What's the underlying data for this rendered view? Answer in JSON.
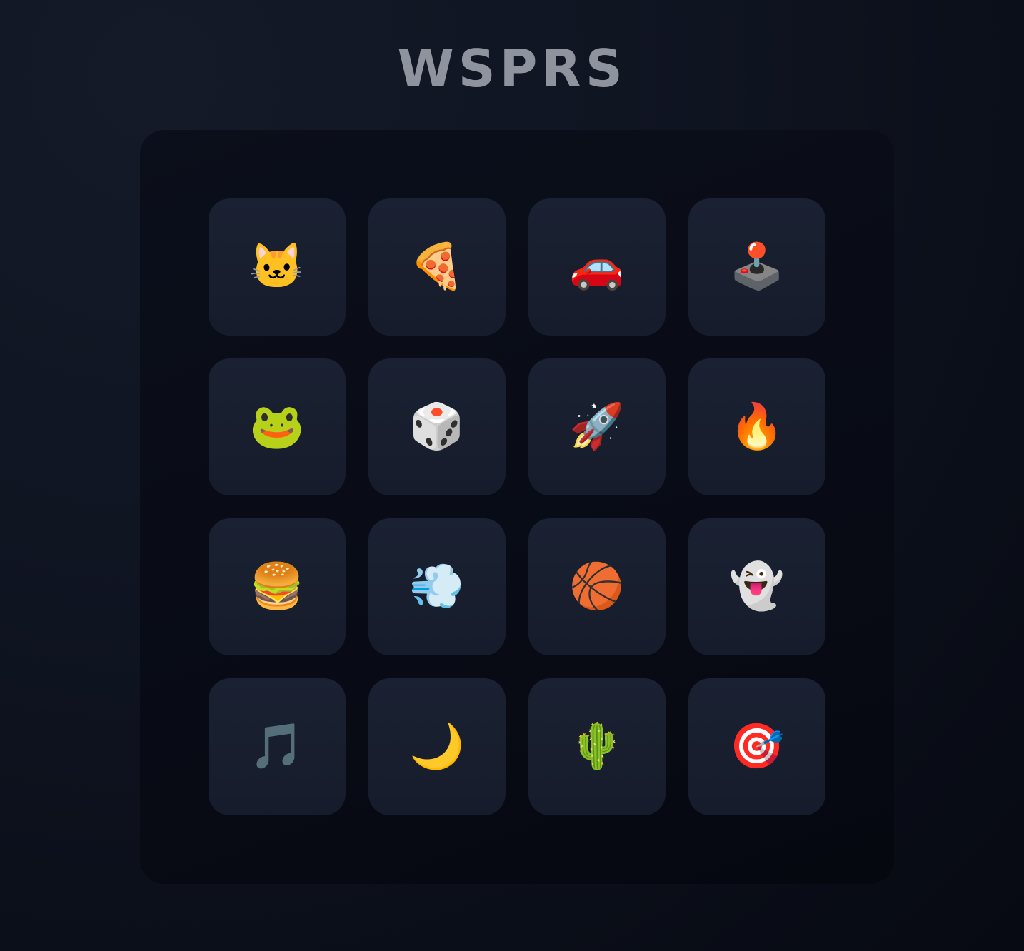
{
  "title": "WSPRS",
  "tiles": [
    {
      "emoji": "🐱",
      "icon": "cat-face-icon"
    },
    {
      "emoji": "🍕",
      "icon": "pizza-icon"
    },
    {
      "emoji": "🚗",
      "icon": "car-icon"
    },
    {
      "emoji": "🕹️",
      "icon": "joystick-icon"
    },
    {
      "emoji": "🐸",
      "icon": "frog-icon"
    },
    {
      "emoji": "🎲",
      "icon": "die-icon"
    },
    {
      "emoji": "🚀",
      "icon": "rocket-icon"
    },
    {
      "emoji": "🔥",
      "icon": "fire-icon"
    },
    {
      "emoji": "🍔",
      "icon": "hamburger-icon"
    },
    {
      "emoji": "💨",
      "icon": "dash-smoke-icon"
    },
    {
      "emoji": "🏀",
      "icon": "basketball-icon"
    },
    {
      "emoji": "👻",
      "icon": "ghost-icon"
    },
    {
      "emoji": "🎵",
      "icon": "musical-note-icon"
    },
    {
      "emoji": "🌙",
      "icon": "crescent-moon-icon"
    },
    {
      "emoji": "🌵",
      "icon": "cactus-icon"
    },
    {
      "emoji": "🎯",
      "icon": "bullseye-icon"
    }
  ]
}
